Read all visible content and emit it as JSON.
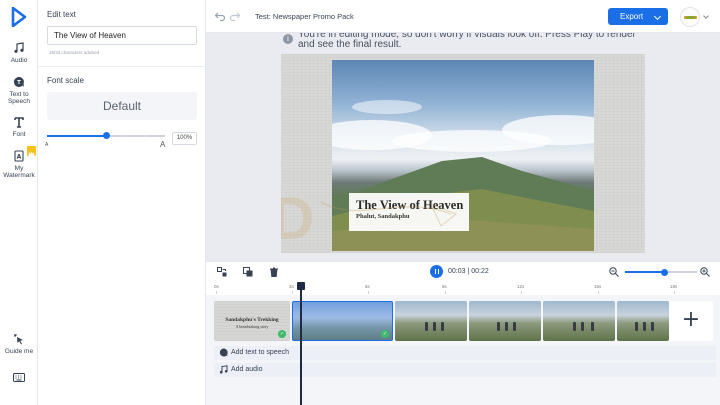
{
  "rail": {
    "items": [
      {
        "label": "Audio",
        "icon": "music-note-icon"
      },
      {
        "label": "Text to Speech",
        "icon": "text-to-speech-icon"
      },
      {
        "label": "Font",
        "icon": "font-icon"
      },
      {
        "label": "My Watermark",
        "icon": "watermark-icon"
      }
    ],
    "guide": {
      "label": "Guide me",
      "icon": "pointer-click-icon"
    },
    "keyboard_icon": "keyboard-icon"
  },
  "panel": {
    "edit_text_label": "Edit text",
    "text_value": "The View of Heaven",
    "char_hint": "18/33 characters advised",
    "font_scale_label": "Font scale",
    "font_scale_preset": "Default",
    "scale_small": "A",
    "scale_big": "A",
    "scale_percent": "100%",
    "scale_fraction": 0.5
  },
  "topbar": {
    "project_title": "Test: Newspaper Promo Pack",
    "export_label": "Export",
    "accent": "#1a6ee6"
  },
  "canvas": {
    "info_text": "You're in editing mode, so don't worry if visuals look off. Press Play to render and see the final result.",
    "caption_title": "The View of Heaven",
    "caption_subtitle": "Phalut, Sandakphu"
  },
  "timeline": {
    "current_time": "00:03",
    "total_time": "00:22",
    "zoom_fraction": 0.55,
    "ruler": [
      "0s",
      "3s",
      "6s",
      "9s",
      "12s",
      "15s",
      "18s"
    ],
    "first_clip_title": "Sandakphu's Trekking",
    "first_clip_subtitle": "A breathtaking story",
    "tracks": [
      {
        "label": "Add text to speech",
        "icon": "speech-icon"
      },
      {
        "label": "Add audio",
        "icon": "music-note-icon"
      }
    ]
  }
}
